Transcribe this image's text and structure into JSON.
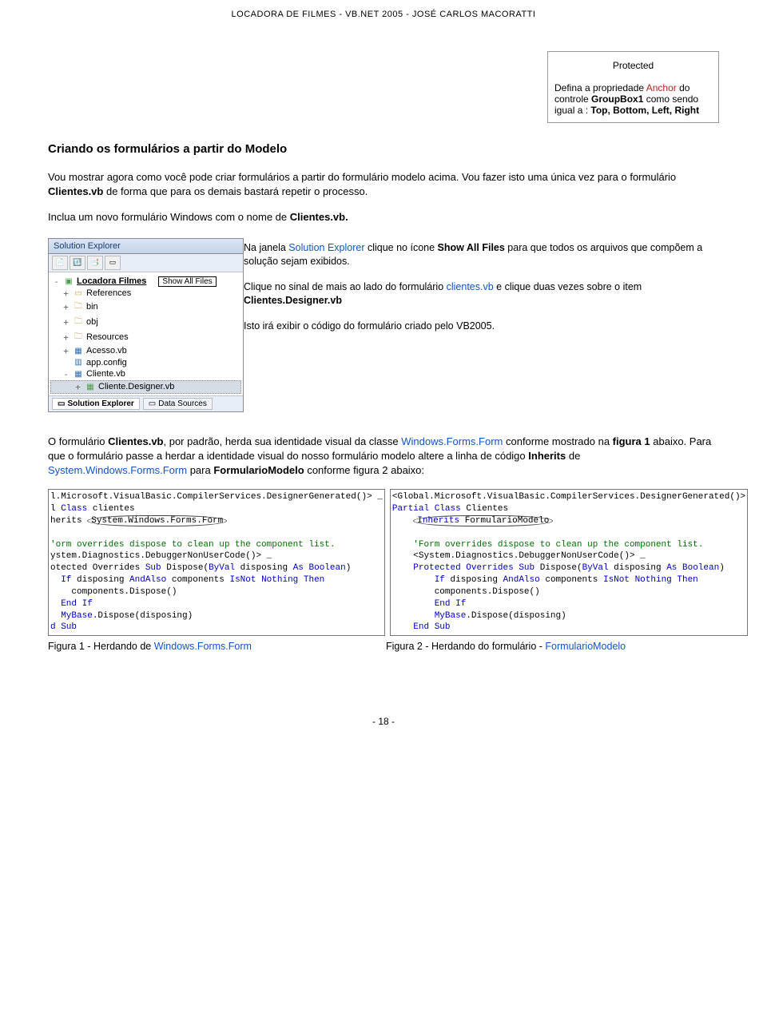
{
  "header": "LOCADORA DE FILMES  - VB.NET 2005 - JOSÉ CARLOS MACORATTI",
  "topbox": {
    "protected": "Protected",
    "line1a": "Defina a propriedade ",
    "line1b": "Anchor",
    "line1c": " do controle ",
    "line2a": "GroupBox1",
    "line2b": " como sendo igual a : ",
    "line2c": "Top, Bottom, Left, Right"
  },
  "h2": "Criando os formulários a partir do Modelo",
  "p1a": "Vou mostrar agora como você pode criar formulários a partir do formulário modelo acima. Vou fazer isto uma única vez para o formulário ",
  "p1b": "Clientes.vb",
  "p1c": " de forma que para os demais bastará repetir o processo.",
  "p2a": "Inclua um novo formulário Windows com o nome de ",
  "p2b": "Clientes.vb.",
  "se": {
    "title": "Solution Explorer",
    "project": "Locadora Filmes",
    "callout": "Show All Files",
    "nodes": [
      "References",
      "bin",
      "obj",
      "Resources",
      "Acesso.vb",
      "app.config",
      "Cliente.vb",
      "Cliente.Designer.vb"
    ],
    "tab1": "Solution Explorer",
    "tab2": "Data Sources"
  },
  "setext": {
    "p1a": "Na janela ",
    "p1b": "Solution Explorer",
    "p1c": " clique no ícone ",
    "p1d": "Show All Files",
    "p1e": " para que todos os arquivos que compõem a solução sejam exibidos.",
    "p2a": "Clique no sinal de mais ao lado do formulário ",
    "p2b": "clientes.vb",
    "p2c": " e clique duas vezes sobre o item ",
    "p2d": "Clientes.Designer.vb",
    "p3": "Isto irá exibir o código do formulário criado pelo VB2005."
  },
  "p3": {
    "a": "O formulário ",
    "b": "Clientes.vb",
    "c": ", por padrão, herda sua identidade visual da classe ",
    "d": "Windows.Forms.Form",
    "e": " conforme mostrado na ",
    "f": "figura 1",
    "g": " abaixo. Para que o formulário passe a herdar a identidade visual do nosso formulário modelo altere a linha de código ",
    "h": "Inherits",
    "i": " de ",
    "j": "System.Windows.Forms.Form",
    "k": " para ",
    "l": "FormularioModelo",
    "m": " conforme figura 2 abaixo:"
  },
  "code1": {
    "l1a": "l.Microsoft.VisualBasic.CompilerServices.DesignerGenerated()>",
    "l1b": "_",
    "l2a": "l ",
    "l2b": "Class",
    "l2c": " clientes",
    "l3a": "herits ",
    "l3b": "System.Windows.Forms.Form",
    "l4": "'orm overrides dispose to clean up the component list.",
    "l5": "ystem.Diagnostics.DebuggerNonUserCode()> _",
    "l6a": "otected Overrides ",
    "l6b": "Sub",
    "l6c": " Dispose(",
    "l6d": "ByVal",
    "l6e": " disposing ",
    "l6f": "As Boolean",
    "l6g": ")",
    "l7a": "If",
    "l7b": " disposing ",
    "l7c": "AndAlso",
    "l7d": " components ",
    "l7e": "IsNot Nothing Then",
    "l8": "    components.Dispose()",
    "l9": "End If",
    "l10a": "MyBase",
    "l10b": ".Dispose(disposing)",
    "l11": "d Sub"
  },
  "code2": {
    "l1": "<Global.Microsoft.VisualBasic.CompilerServices.DesignerGenerated()>",
    "l2a": "Partial ",
    "l2b": "Class",
    "l2c": " Clientes",
    "l3a": "Inherits",
    "l3b": " FormularioModelo",
    "l4": "'Form overrides dispose to clean up the component list.",
    "l5": "<System.Diagnostics.DebuggerNonUserCode()> _",
    "l6a": "Protected Overrides ",
    "l6b": "Sub",
    "l6c": " Dispose(",
    "l6d": "ByVal",
    "l6e": " disposing ",
    "l6f": "As Boolean",
    "l6g": ")",
    "l7a": "If",
    "l7b": " disposing ",
    "l7c": "AndAlso",
    "l7d": " components ",
    "l7e": "IsNot Nothing Then",
    "l8": "        components.Dispose()",
    "l9": "End If",
    "l10a": "MyBase",
    "l10b": ".Dispose(disposing)",
    "l11": "End Sub"
  },
  "cap1a": "Figura 1 - Herdando de ",
  "cap1b": "Windows.Forms.Form",
  "cap2a": "Figura 2 - Herdando do formulário - ",
  "cap2b": "FormularioModelo",
  "footer": "- 18 -"
}
